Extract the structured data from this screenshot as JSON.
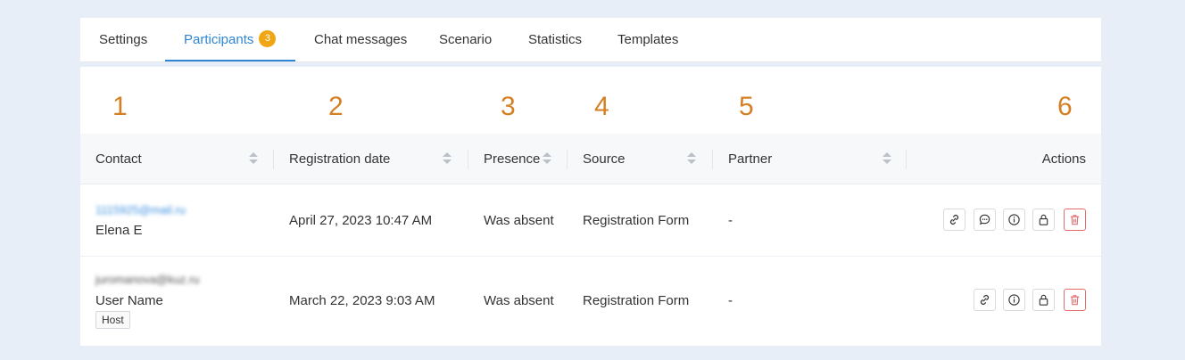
{
  "tabs": [
    {
      "label": "Settings"
    },
    {
      "label": "Participants",
      "badge": "3",
      "active": true
    },
    {
      "label": "Chat messages"
    },
    {
      "label": "Scenario"
    },
    {
      "label": "Statistics"
    },
    {
      "label": "Templates"
    }
  ],
  "column_numbers": [
    "1",
    "2",
    "3",
    "4",
    "5",
    "6"
  ],
  "table": {
    "headers": {
      "contact": "Contact",
      "registration_date": "Registration date",
      "presence": "Presence",
      "source": "Source",
      "partner": "Partner",
      "actions": "Actions"
    },
    "rows": [
      {
        "email": "1115925@mail.ru",
        "name": "Elena E",
        "registration_date": "April 27, 2023 10:47 AM",
        "presence": "Was absent",
        "source": "Registration Form",
        "partner": "-",
        "actions": [
          "link-icon",
          "chat-icon",
          "info-icon",
          "lock-icon",
          "trash-icon"
        ]
      },
      {
        "email": "juromanova@kuz.ru",
        "name": "User Name",
        "tag": "Host",
        "registration_date": "March 22, 2023 9:03 AM",
        "presence": "Was absent",
        "source": "Registration Form",
        "partner": "-",
        "actions": [
          "link-icon",
          "info-icon",
          "lock-icon",
          "trash-icon"
        ]
      }
    ]
  },
  "colors": {
    "accent": "#2f86d6",
    "badge": "#f0a513",
    "annotation": "#d47f24",
    "danger": "#e36d6d"
  }
}
